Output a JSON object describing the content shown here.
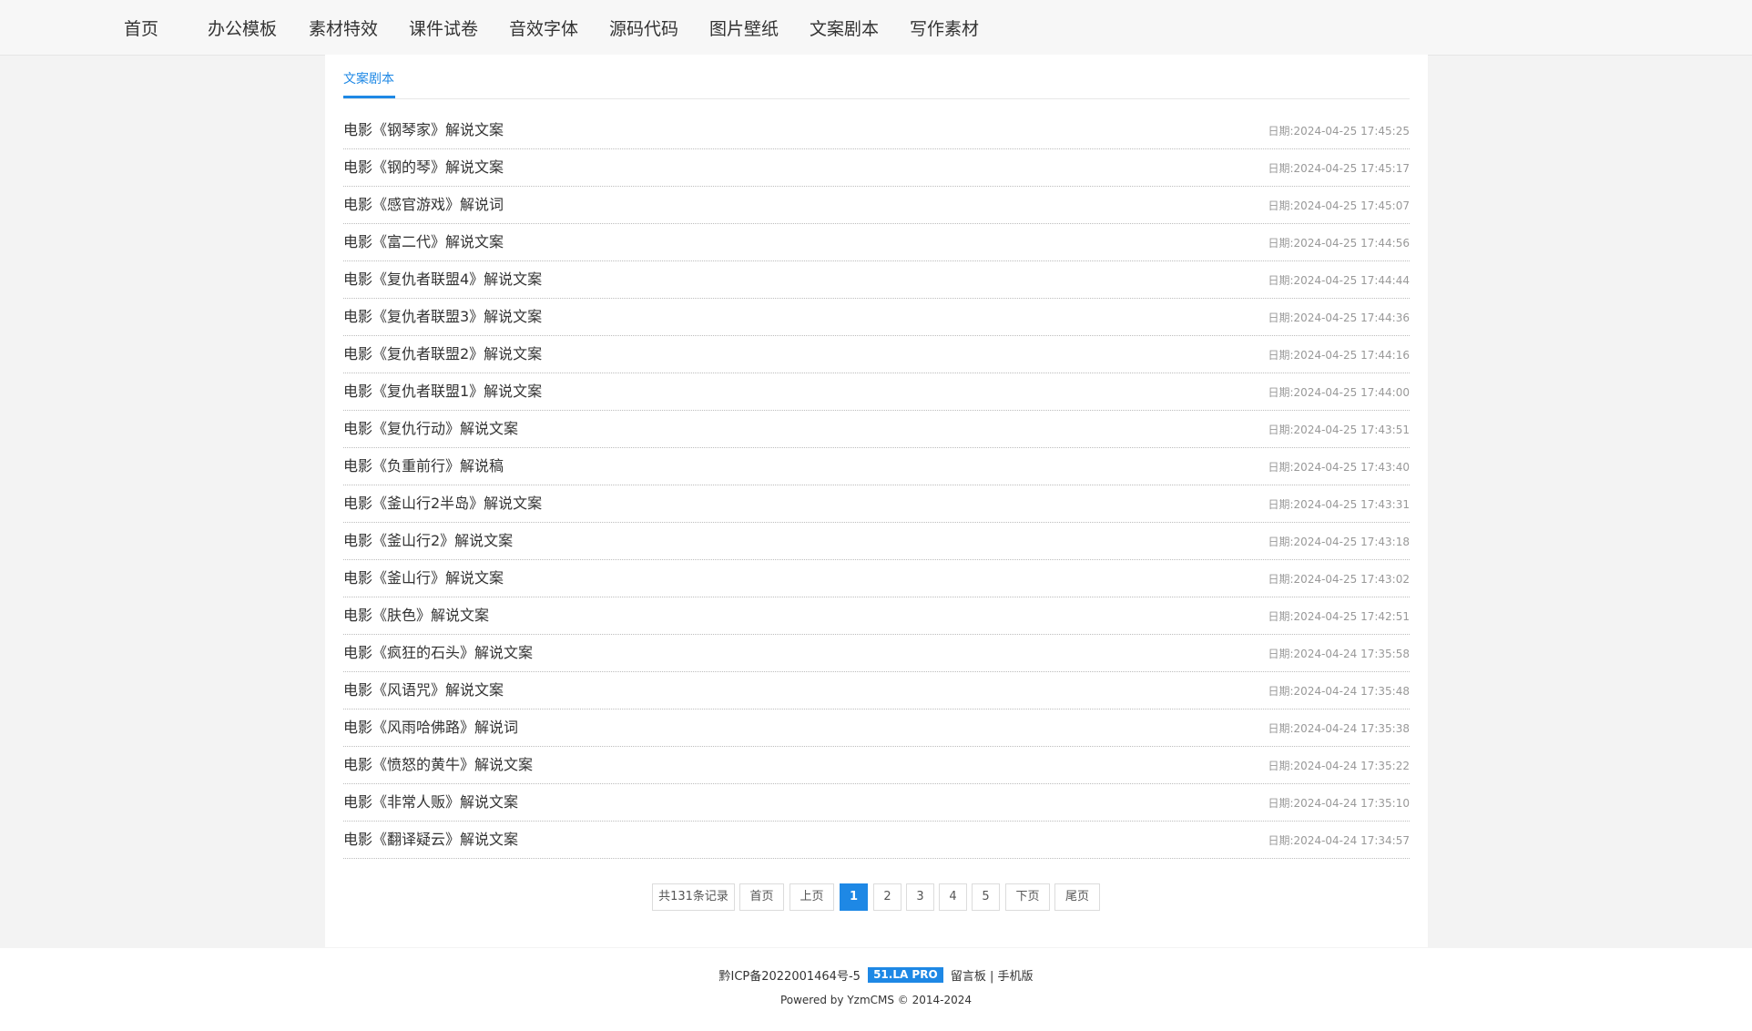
{
  "nav": {
    "items": [
      {
        "label": "首页"
      },
      {
        "label": "办公模板"
      },
      {
        "label": "素材特效"
      },
      {
        "label": "课件试卷"
      },
      {
        "label": "音效字体"
      },
      {
        "label": "源码代码"
      },
      {
        "label": "图片壁纸"
      },
      {
        "label": "文案剧本"
      },
      {
        "label": "写作素材"
      }
    ]
  },
  "section": {
    "tab_label": "文案剧本"
  },
  "list": {
    "date_prefix": "日期:",
    "items": [
      {
        "title": "电影《钢琴家》解说文案",
        "date": "日期:2024-04-25 17:45:25"
      },
      {
        "title": "电影《钢的琴》解说文案",
        "date": "日期:2024-04-25 17:45:17"
      },
      {
        "title": "电影《感官游戏》解说词",
        "date": "日期:2024-04-25 17:45:07"
      },
      {
        "title": "电影《富二代》解说文案",
        "date": "日期:2024-04-25 17:44:56"
      },
      {
        "title": "电影《复仇者联盟4》解说文案",
        "date": "日期:2024-04-25 17:44:44"
      },
      {
        "title": "电影《复仇者联盟3》解说文案",
        "date": "日期:2024-04-25 17:44:36"
      },
      {
        "title": "电影《复仇者联盟2》解说文案",
        "date": "日期:2024-04-25 17:44:16"
      },
      {
        "title": "电影《复仇者联盟1》解说文案",
        "date": "日期:2024-04-25 17:44:00"
      },
      {
        "title": "电影《复仇行动》解说文案",
        "date": "日期:2024-04-25 17:43:51"
      },
      {
        "title": "电影《负重前行》解说稿",
        "date": "日期:2024-04-25 17:43:40"
      },
      {
        "title": "电影《釜山行2半岛》解说文案",
        "date": "日期:2024-04-25 17:43:31"
      },
      {
        "title": "电影《釜山行2》解说文案",
        "date": "日期:2024-04-25 17:43:18"
      },
      {
        "title": "电影《釜山行》解说文案",
        "date": "日期:2024-04-25 17:43:02"
      },
      {
        "title": "电影《肤色》解说文案",
        "date": "日期:2024-04-25 17:42:51"
      },
      {
        "title": "电影《疯狂的石头》解说文案",
        "date": "日期:2024-04-24 17:35:58"
      },
      {
        "title": "电影《风语咒》解说文案",
        "date": "日期:2024-04-24 17:35:48"
      },
      {
        "title": "电影《风雨哈佛路》解说词",
        "date": "日期:2024-04-24 17:35:38"
      },
      {
        "title": "电影《愤怒的黄牛》解说文案",
        "date": "日期:2024-04-24 17:35:22"
      },
      {
        "title": "电影《非常人贩》解说文案",
        "date": "日期:2024-04-24 17:35:10"
      },
      {
        "title": "电影《翻译疑云》解说文案",
        "date": "日期:2024-04-24 17:34:57"
      }
    ]
  },
  "pagination": {
    "total": "共131条记录",
    "first": "首页",
    "prev": "上页",
    "pages": [
      "1",
      "2",
      "3",
      "4",
      "5"
    ],
    "current": "1",
    "next": "下页",
    "last": "尾页"
  },
  "footer": {
    "icp": "黔ICP备2022001464号-5",
    "badge": "51.LA PRO",
    "guestbook": "留言板",
    "separator": "|",
    "mobile": "手机版",
    "powered": "Powered by YzmCMS © 2014-2024"
  },
  "colors": {
    "accent": "#1e88e5",
    "page_bg": "#f3f3f3",
    "nav_bg": "#f7f7f7"
  }
}
